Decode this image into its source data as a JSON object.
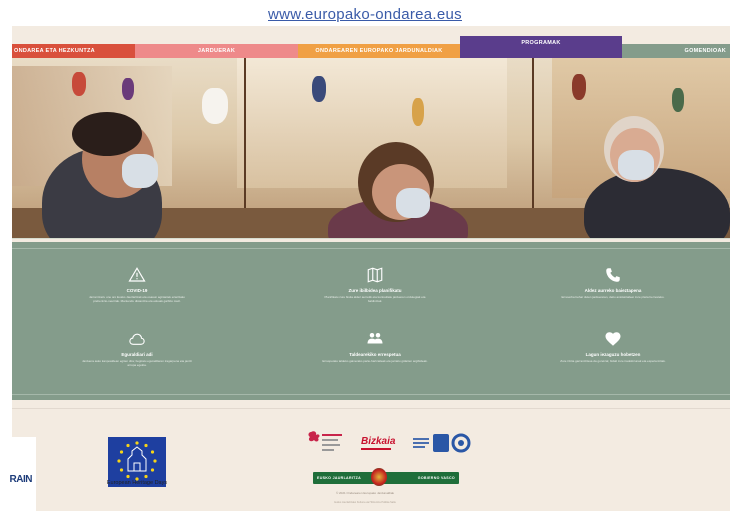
{
  "header": {
    "url": "www.europako-ondarea.eus"
  },
  "nav": {
    "items": [
      {
        "label": "ONDAREA ETA HEZKUNTZA"
      },
      {
        "label": "JARDUERAK"
      },
      {
        "label": "ONDAREAREN EUROPAKO JARDUNALDIAK"
      },
      {
        "label": "PROGRAMAK"
      },
      {
        "label": "GOMENDIOAK"
      }
    ],
    "colors": [
      "#d9503c",
      "#ee8a8a",
      "#f0a044",
      "#5a3d8c",
      "#849c8b"
    ]
  },
  "features": [
    {
      "icon": "warning-icon",
      "title": "COVID-19",
      "desc": "Jarrai itzazu une oro Eusko Jaurlaritzak eta osasun agintariek ezarritako prebentzio-neurriak. Mantendu distantzia eta eskuak garbitu maiz."
    },
    {
      "icon": "map-icon",
      "title": "Zure ibilbidea planifikatu",
      "desc": "Planifikatu zure bisita aldez aurretik eta kontsultatu jardueren ordutegiak eta baldintzak."
    },
    {
      "icon": "phone-icon",
      "title": "Aldez aurreko baieztapena",
      "desc": "Erreserba behar duten jardueretan, deitu antolatzaileei zure plaza berresteko."
    },
    {
      "icon": "cloud-icon",
      "title": "Eguraldiari adi",
      "desc": "Jarduera asko kanpoaldean egiten dira; begiratu eguraldiaren iragarpena eta jantzi arropa egokia."
    },
    {
      "icon": "people-icon",
      "title": "Taldearekiko errespetua",
      "desc": "Errespetatu taldeko gainerako parte-hartzaileak eta jarraitu gidarien argibideak."
    },
    {
      "icon": "heart-icon",
      "title": "Lagun iezaguzu hobetzen",
      "desc": "Zure iritzia garrantzitsua da guretzat; bidali zure iradokizunak eta esperientziak."
    }
  ],
  "footer": {
    "logos": [
      "Bizkaia"
    ],
    "gv_left": "EUSKO JAURLARITZA",
    "gv_right": "GOBIERNO VASCO",
    "copyright": "© 2021 Ondarearen Europako Jardunaldiak",
    "fineprint": "Eusko Jaurlaritzako Kultura eta Hizkuntza Politika Saila"
  },
  "overlay": {
    "rain": "RAIN",
    "ehd_label": "European Heritage Days"
  }
}
